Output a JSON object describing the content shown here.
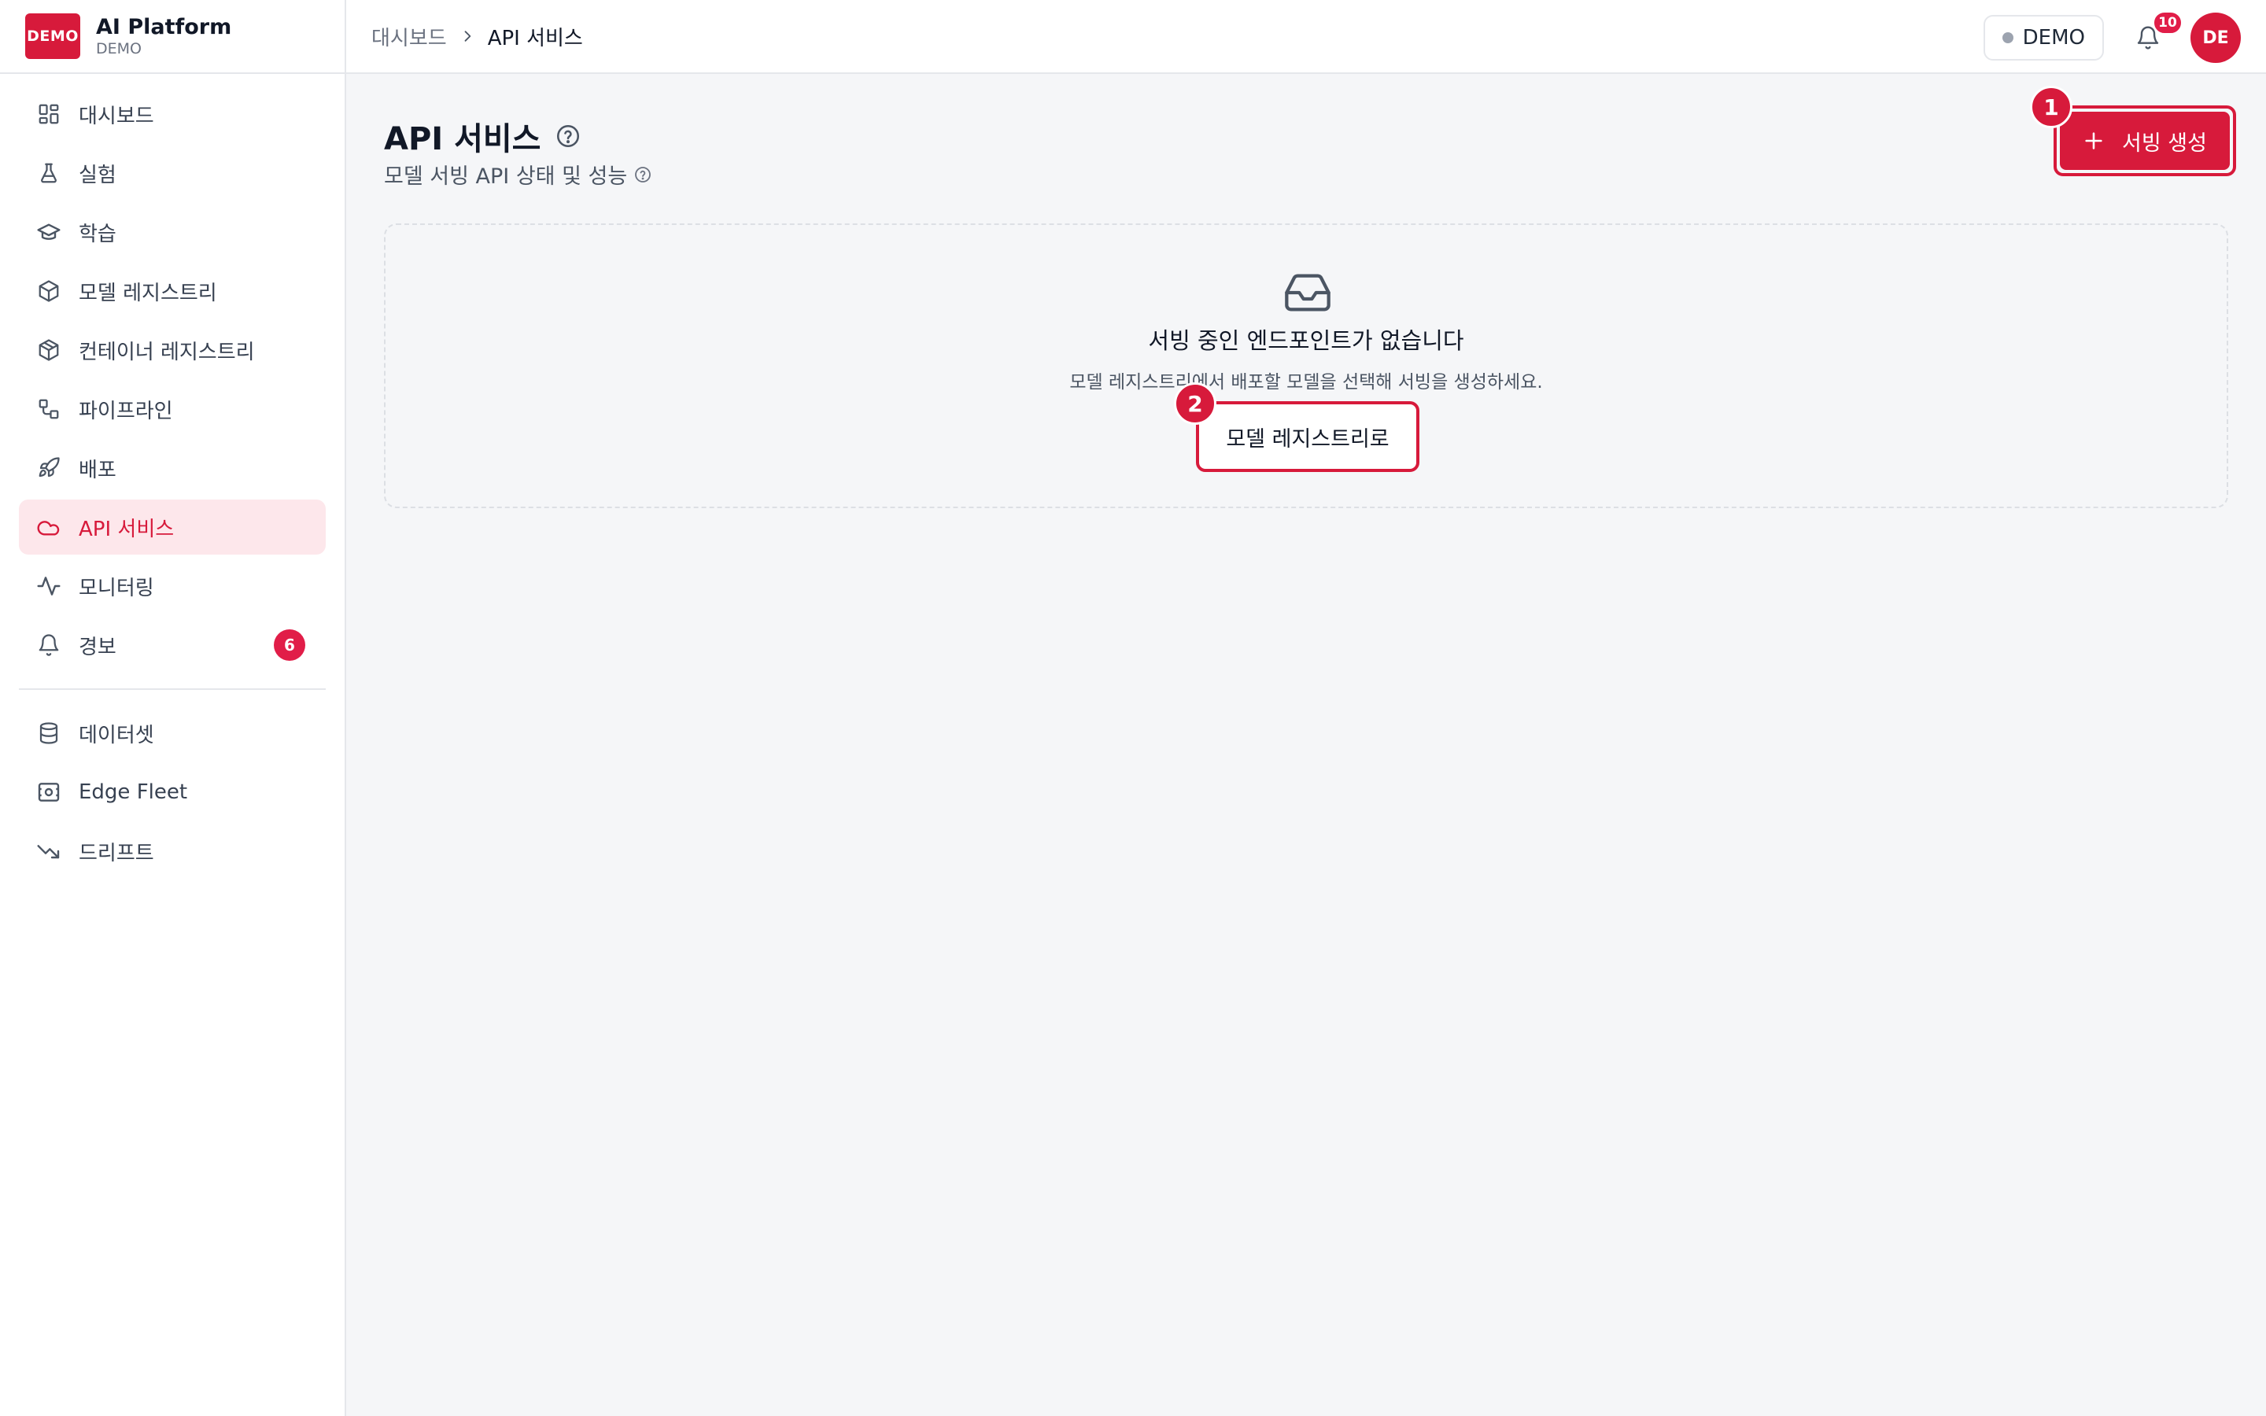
{
  "brand": {
    "logo_text": "DEMO",
    "name": "AI Platform",
    "sub": "DEMO"
  },
  "sidebar": {
    "items": [
      {
        "label": "대시보드",
        "icon": "dashboard-grid-icon"
      },
      {
        "label": "실험",
        "icon": "flask-icon"
      },
      {
        "label": "학습",
        "icon": "graduation-cap-icon"
      },
      {
        "label": "모델 레지스트리",
        "icon": "box-icon"
      },
      {
        "label": "컨테이너 레지스트리",
        "icon": "container-box-icon"
      },
      {
        "label": "파이프라인",
        "icon": "pipeline-icon"
      },
      {
        "label": "배포",
        "icon": "rocket-icon"
      },
      {
        "label": "API 서비스",
        "icon": "cloud-icon",
        "active": true
      },
      {
        "label": "모니터링",
        "icon": "activity-icon"
      },
      {
        "label": "경보",
        "icon": "bell-icon",
        "badge": "6"
      }
    ],
    "secondary_items": [
      {
        "label": "데이터셋",
        "icon": "database-icon"
      },
      {
        "label": "Edge Fleet",
        "icon": "edge-device-icon"
      },
      {
        "label": "드리프트",
        "icon": "trending-down-icon"
      }
    ]
  },
  "topbar": {
    "breadcrumb_parent": "대시보드",
    "breadcrumb_current": "API 서비스",
    "env_label": "DEMO",
    "notification_count": "10",
    "avatar_initials": "DE"
  },
  "page": {
    "title": "API 서비스",
    "subtitle": "모델 서빙 API 상태 및 성능",
    "create_button": "서빙 생성",
    "step1": "1",
    "step2": "2"
  },
  "empty_state": {
    "title": "서빙 중인 엔드포인트가 없습니다",
    "description": "모델 레지스트리에서 배포할 모델을 선택해 서빙을 생성하세요.",
    "button": "모델 레지스트리로"
  },
  "colors": {
    "accent": "#d71a3b",
    "active_bg": "#fde7eb",
    "badge": "#e11d48"
  }
}
